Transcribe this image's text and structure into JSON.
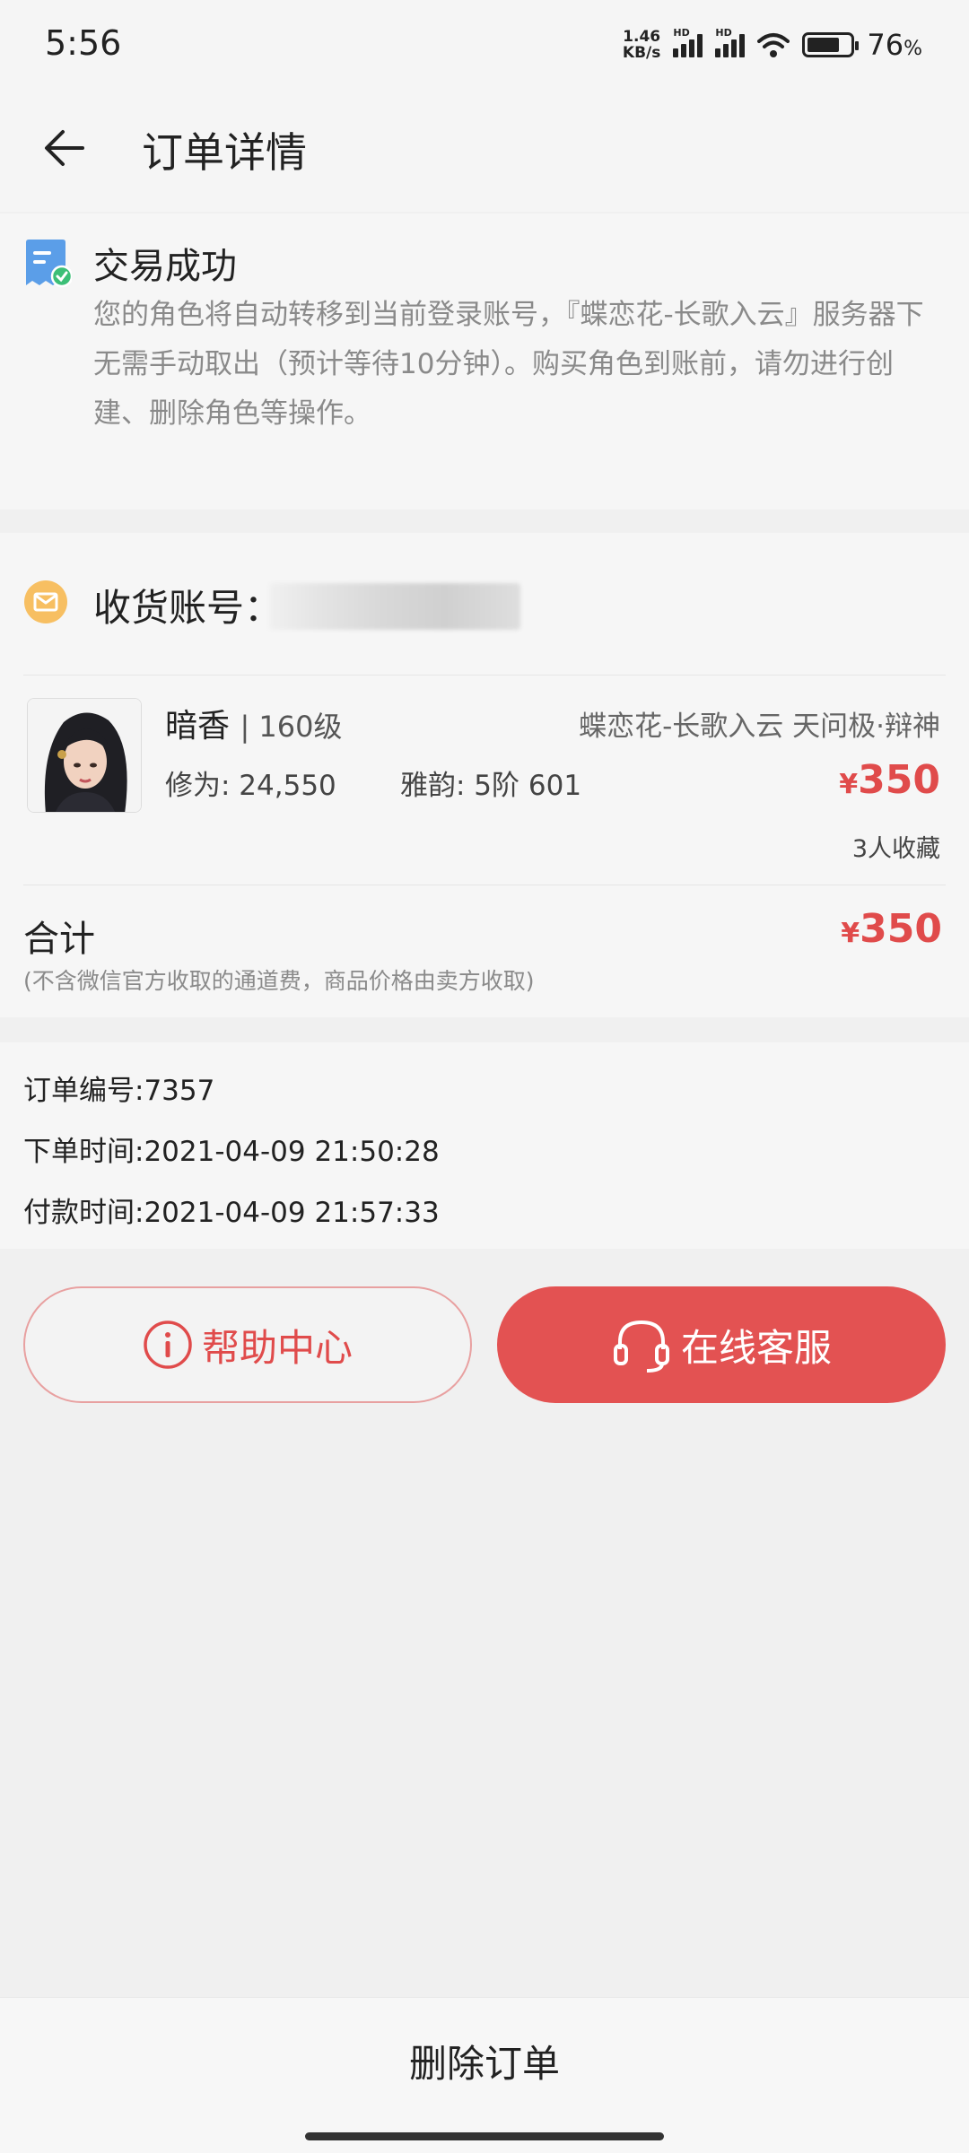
{
  "status_bar": {
    "time": "5:56",
    "net_speed_value": "1.46",
    "net_speed_unit": "KB/s",
    "signal_tag": "HD",
    "battery_value": "76",
    "battery_unit": "%"
  },
  "header": {
    "title": "订单详情"
  },
  "order_status": {
    "title": "交易成功",
    "description": "您的角色将自动转移到当前登录账号，『蝶恋花-长歌入云』服务器下无需手动取出（预计等待10分钟）。购买角色到账前，请勿进行创建、删除角色等操作。"
  },
  "order": {
    "account_label": "收货账号：",
    "item": {
      "name": "暗香",
      "level": "| 160级",
      "server": "蝶恋花-长歌入云 天问极·辩神",
      "xiuwei": "修为: 24,550",
      "yayun": "雅韵: 5阶 601",
      "currency": "¥",
      "price": "350",
      "favorites": "3人收藏"
    },
    "total_label": "合计",
    "total_currency": "¥",
    "total_price": "350",
    "total_note": "(不含微信官方收取的通道费，商品价格由卖方收取)"
  },
  "info": {
    "order_no": "订单编号:7357",
    "order_time": "下单时间:2021-04-09 21:50:28",
    "pay_time": "付款时间:2021-04-09 21:57:33"
  },
  "buttons": {
    "help": "帮助中心",
    "service": "在线客服"
  },
  "bottom": {
    "delete": "删除订单"
  },
  "colors": {
    "accent": "#e04b4b",
    "service_button": "#e35252",
    "background": "#f0f0f0"
  },
  "icons": {
    "back": "arrow-left-icon",
    "status": "document-check-icon",
    "account": "mail-icon",
    "help": "info-circle-icon",
    "service": "headset-icon"
  }
}
